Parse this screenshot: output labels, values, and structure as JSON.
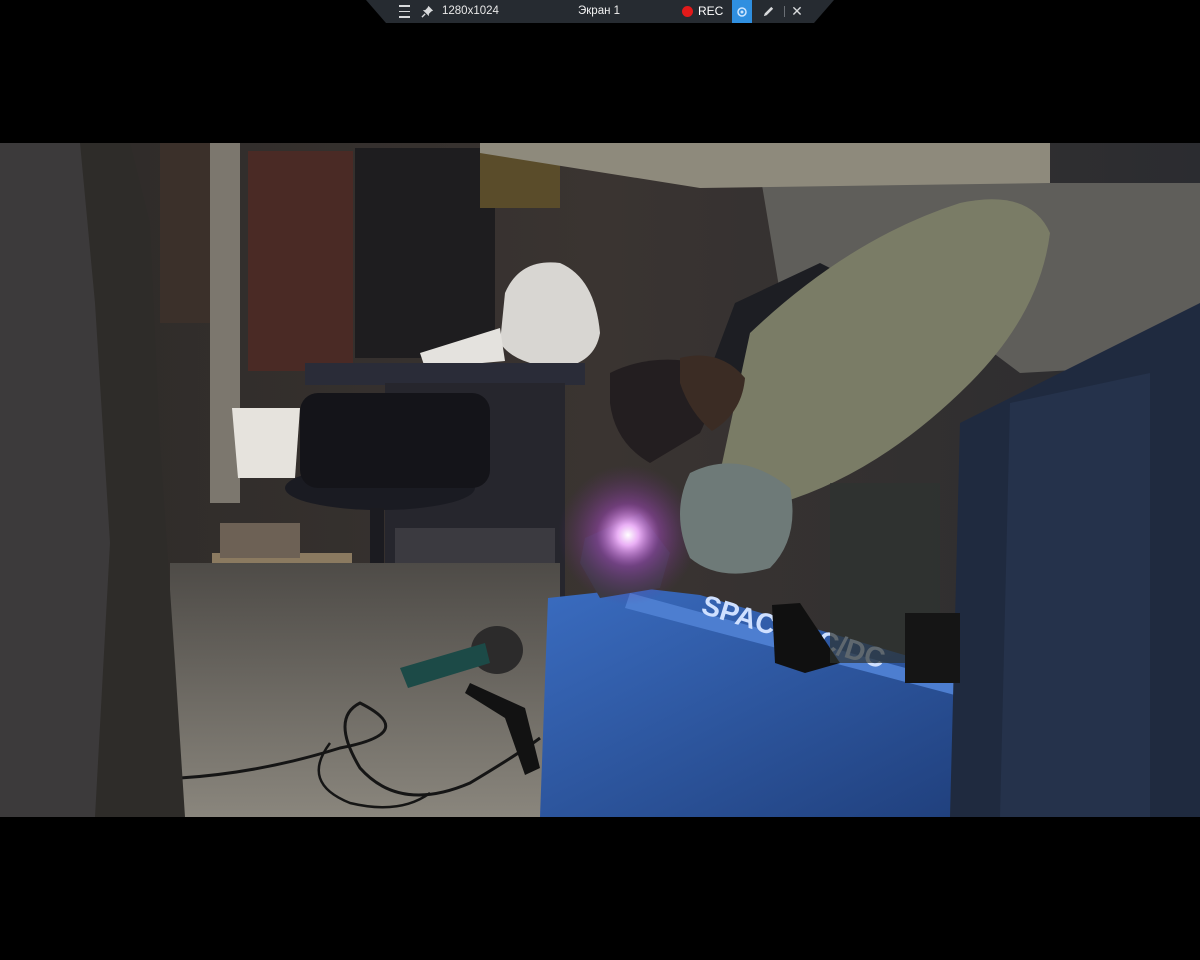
{
  "toolbar": {
    "menu_icon": "menu-icon",
    "pin_icon": "pin-icon",
    "resolution": "1280x1024",
    "screen_name": "Экран 1",
    "rec_label": "REC",
    "camera_icon": "camera-icon",
    "pen_icon": "pen-icon",
    "close_icon": "close-icon",
    "colors": {
      "background": "#262b31",
      "rec_dot": "#e21a1a",
      "camera_active": "#2f8fe0"
    }
  },
  "frame": {
    "content": "photo",
    "colors": {
      "welder_body": "#2f5fae",
      "spark": "#f3b6ff",
      "sleeve": "#7a7c66",
      "floor": "#7d7a72"
    },
    "welder_label": "SPACE AC/DC"
  }
}
